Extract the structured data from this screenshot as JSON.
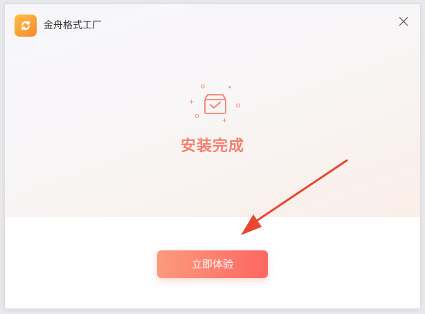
{
  "app": {
    "title": "金舟格式工厂",
    "logo_icon": "refresh-icon",
    "brand_color": "#f7962f"
  },
  "window_controls": {
    "close_icon": "close-icon"
  },
  "main": {
    "status_icon": "install-box-check-icon",
    "status_text": "安装完成",
    "status_color": "#f47f6b",
    "annotation": "red-arrow-pointing-to-button",
    "primary_button": {
      "label": "立即体验",
      "gradient": [
        "#fb9a7d",
        "#fd6763"
      ]
    }
  }
}
